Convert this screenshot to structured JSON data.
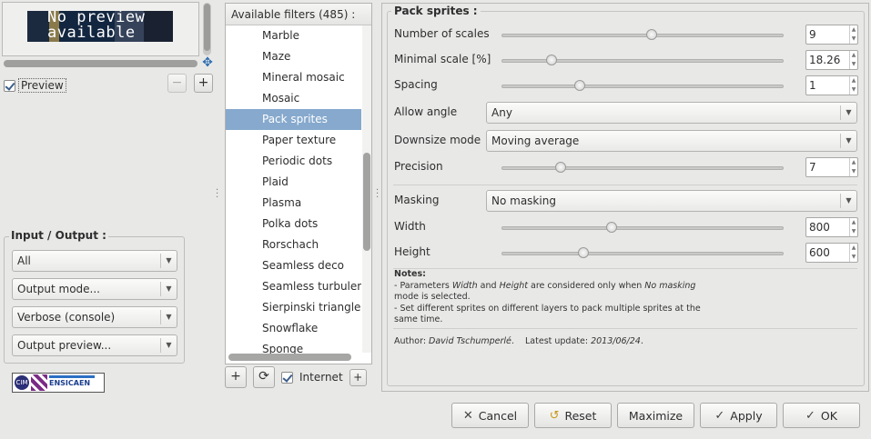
{
  "preview": {
    "image_text_line1": "No preview",
    "image_text_line2": "available",
    "checkbox_label": "Preview",
    "zoom_out": "−",
    "zoom_in": "+"
  },
  "io_group": {
    "title": "Input / Output :",
    "input_layers": "All",
    "output_mode": "Output mode...",
    "verbose": "Verbose (console)",
    "output_preview": "Output preview..."
  },
  "logo": {
    "cim_text": "CIM",
    "ensicaen_text": "ENSICAEN"
  },
  "filters": {
    "header": "Available filters (485) :",
    "items": [
      "Marble",
      "Maze",
      "Mineral mosaic",
      "Mosaic",
      "Pack sprites",
      "Paper texture",
      "Periodic dots",
      "Plaid",
      "Plasma",
      "Polka dots",
      "Rorschach",
      "Seamless deco",
      "Seamless turbulence",
      "Sierpinski triangle",
      "Snowflake",
      "Sponge"
    ],
    "selected": "Pack sprites",
    "add": "+",
    "refresh": "⟳",
    "internet_label": "Internet",
    "expand": "+"
  },
  "params": {
    "title": "Pack sprites :",
    "number_of_scales": {
      "label": "Number of scales",
      "value": "9",
      "min": 1,
      "max": 16
    },
    "minimal_scale": {
      "label": "Minimal scale [%]",
      "value": "18.26",
      "min": 1,
      "max": 100
    },
    "spacing": {
      "label": "Spacing",
      "value": "1",
      "min": -10,
      "max": 30
    },
    "allow_angle": {
      "label": "Allow angle",
      "value": "Any"
    },
    "downsize_mode": {
      "label": "Downsize mode",
      "value": "Moving average"
    },
    "precision": {
      "label": "Precision",
      "value": "7",
      "min": 1,
      "max": 30
    },
    "masking": {
      "label": "Masking",
      "value": "No masking"
    },
    "width": {
      "label": "Width",
      "value": "800",
      "min": 8,
      "max": 2048
    },
    "height": {
      "label": "Height",
      "value": "600",
      "min": 8,
      "max": 2048
    },
    "notes_title": "Notes:",
    "notes_line1": " - Parameters Width and Height are considered only when No masking",
    "notes_line2": "mode is selected.",
    "notes_line3": " - Set different sprites on different layers to pack multiple sprites at the",
    "notes_line4": "same time.",
    "author": "Author: David Tschumperlé.    Latest update: 2013/06/24."
  },
  "buttons": {
    "cancel": "Cancel",
    "reset": "Reset",
    "maximize": "Maximize",
    "apply": "Apply",
    "ok": "OK"
  }
}
